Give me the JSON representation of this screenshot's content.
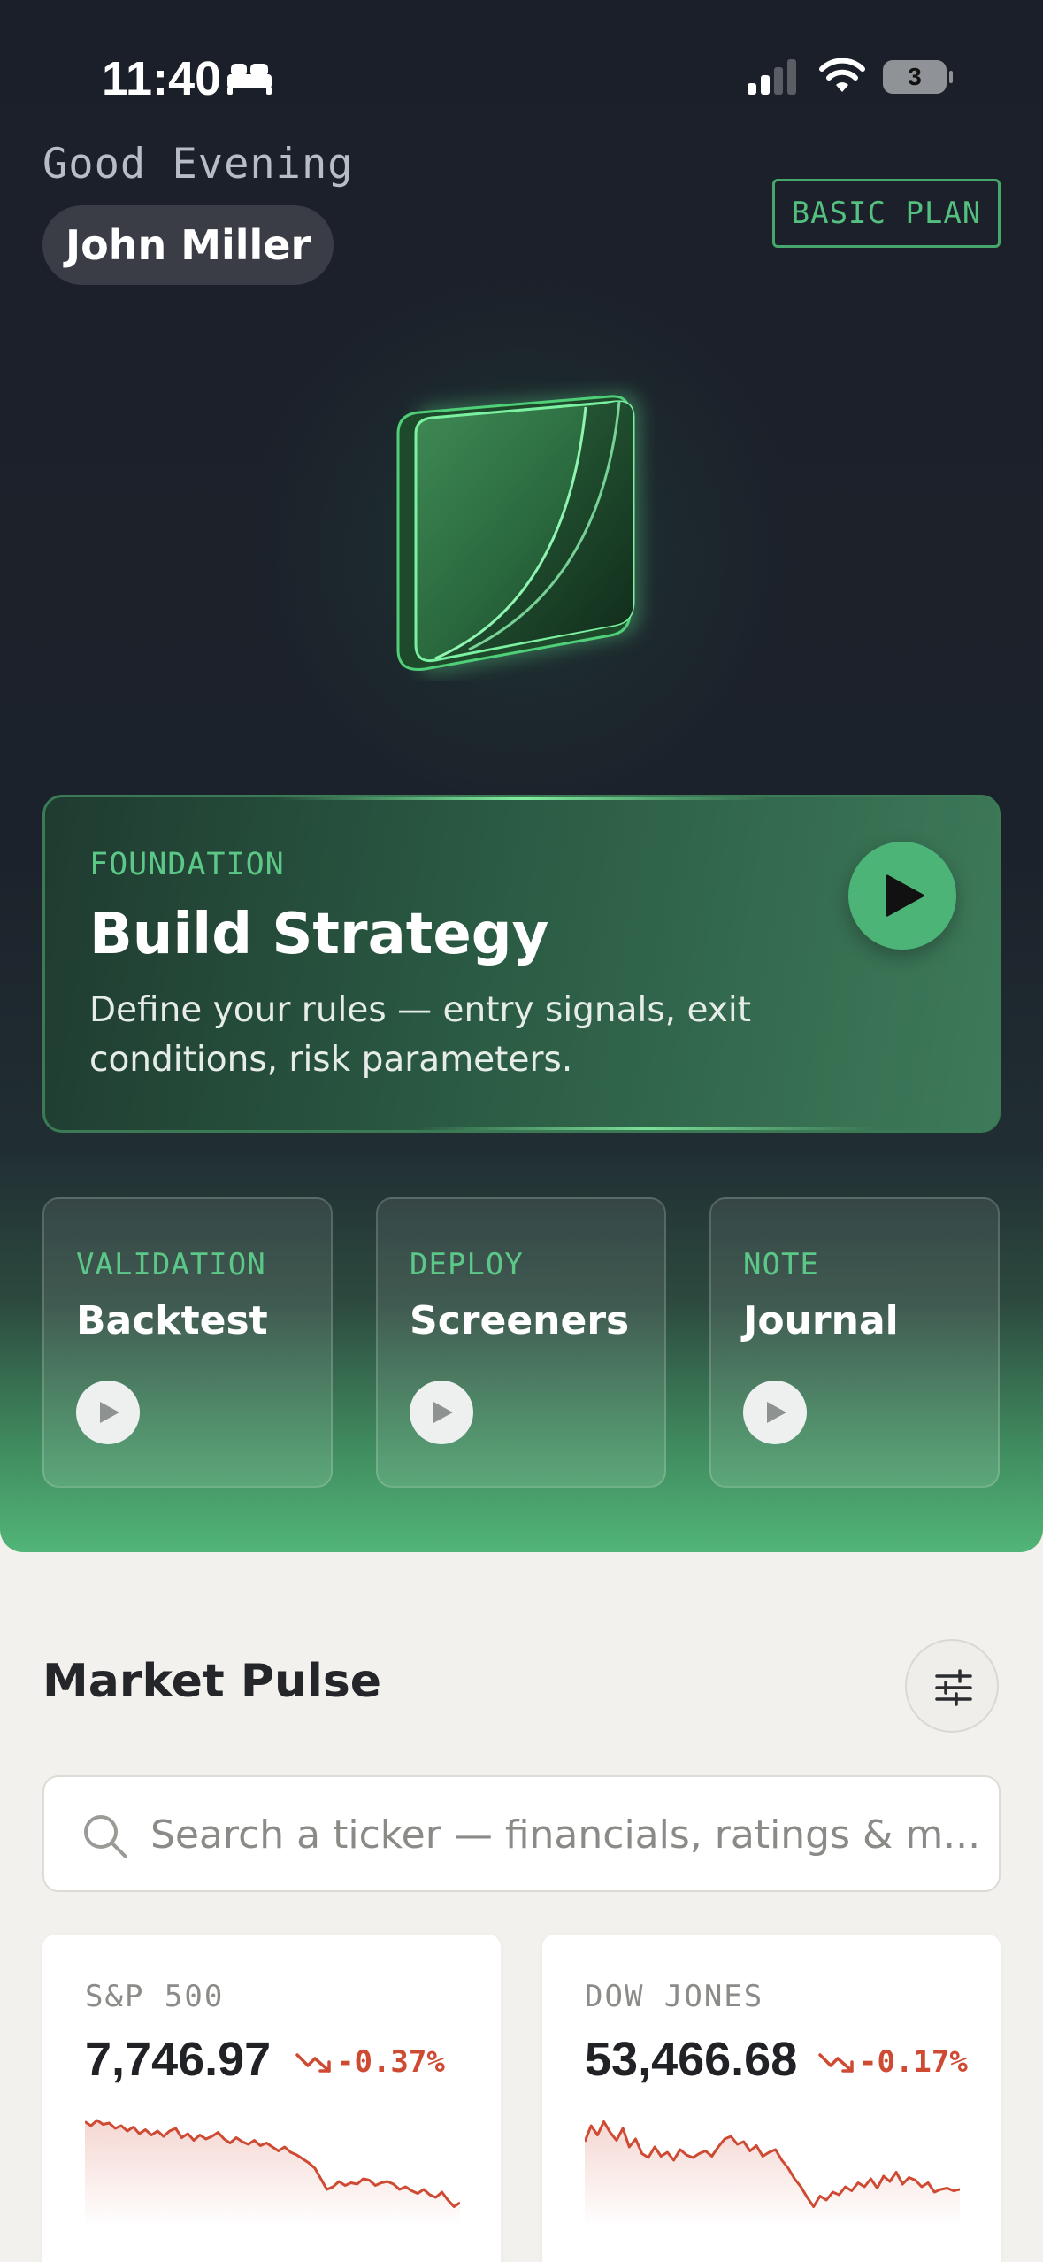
{
  "status_bar": {
    "time": "11:40",
    "battery_level": "3"
  },
  "header": {
    "greeting": "Good Evening",
    "user_name": "John Miller",
    "plan_badge": "BASIC PLAN"
  },
  "feature_card": {
    "eyebrow": "FOUNDATION",
    "title": "Build Strategy",
    "description": "Define your rules — entry signals, exit conditions, risk parameters."
  },
  "mini_cards": [
    {
      "eyebrow": "VALIDATION",
      "title": "Backtest"
    },
    {
      "eyebrow": "DEPLOY",
      "title": "Screeners"
    },
    {
      "eyebrow": "NOTE",
      "title": "Journal"
    }
  ],
  "market_pulse": {
    "title": "Market Pulse",
    "search_placeholder": "Search a ticker — financials, ratings & m...",
    "indices": [
      {
        "name": "S&P 500",
        "value": "7,746.97",
        "change": "-0.37%",
        "spark": [
          71,
          68,
          72,
          69,
          70,
          66,
          68,
          64,
          67,
          62,
          65,
          61,
          64,
          60,
          64,
          66,
          59,
          62,
          57,
          61,
          58,
          60,
          63,
          58,
          55,
          59,
          56,
          54,
          57,
          53,
          55,
          52,
          49,
          52,
          48,
          46,
          43,
          40,
          36,
          28,
          20,
          22,
          26,
          23,
          25,
          24,
          28,
          27,
          23,
          25,
          26,
          24,
          20,
          22,
          19,
          17,
          20,
          16,
          14,
          18,
          12,
          7,
          10
        ]
      },
      {
        "name": "DOW JONES",
        "value": "53,466.68",
        "change": "-0.17%",
        "spark": [
          56,
          68,
          61,
          71,
          63,
          57,
          66,
          52,
          58,
          47,
          44,
          52,
          45,
          48,
          42,
          50,
          46,
          44,
          47,
          49,
          45,
          52,
          58,
          60,
          54,
          56,
          49,
          53,
          45,
          48,
          50,
          42,
          36,
          28,
          22,
          14,
          7,
          15,
          12,
          18,
          16,
          22,
          19,
          25,
          22,
          28,
          21,
          30,
          26,
          33,
          24,
          29,
          27,
          22,
          25,
          18,
          20,
          21,
          19,
          20
        ]
      }
    ]
  },
  "colors": {
    "accent": "#4cb477",
    "eyebrow": "#5cc888",
    "negative": "#cf4a33",
    "hero_bg": "#1b1f29",
    "page_bg": "#f2f1ee"
  }
}
